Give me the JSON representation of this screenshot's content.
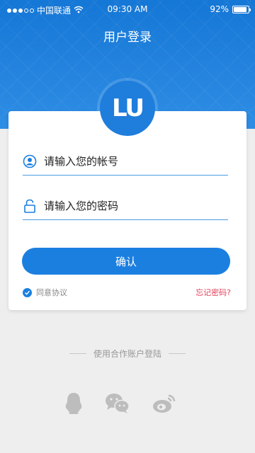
{
  "status_bar": {
    "carrier": "中国联通",
    "time": "09:30 AM",
    "battery": "92%",
    "battery_level": 0.92
  },
  "header": {
    "title": "用户登录"
  },
  "logo": {
    "text": "LU"
  },
  "form": {
    "account_placeholder": "请输入您的帐号",
    "password_placeholder": "请输入您的密码",
    "confirm_label": "确认",
    "agree_label": "同意协议",
    "forgot_label": "忘记密码?"
  },
  "other_login": {
    "title": "使用合作账户登陆",
    "icons": [
      "qq-icon",
      "wechat-icon",
      "weibo-icon"
    ]
  },
  "colors": {
    "primary": "#1b7fe0",
    "header": "#1e7bd8",
    "danger": "#e3415b",
    "background": "#eeeeee"
  }
}
